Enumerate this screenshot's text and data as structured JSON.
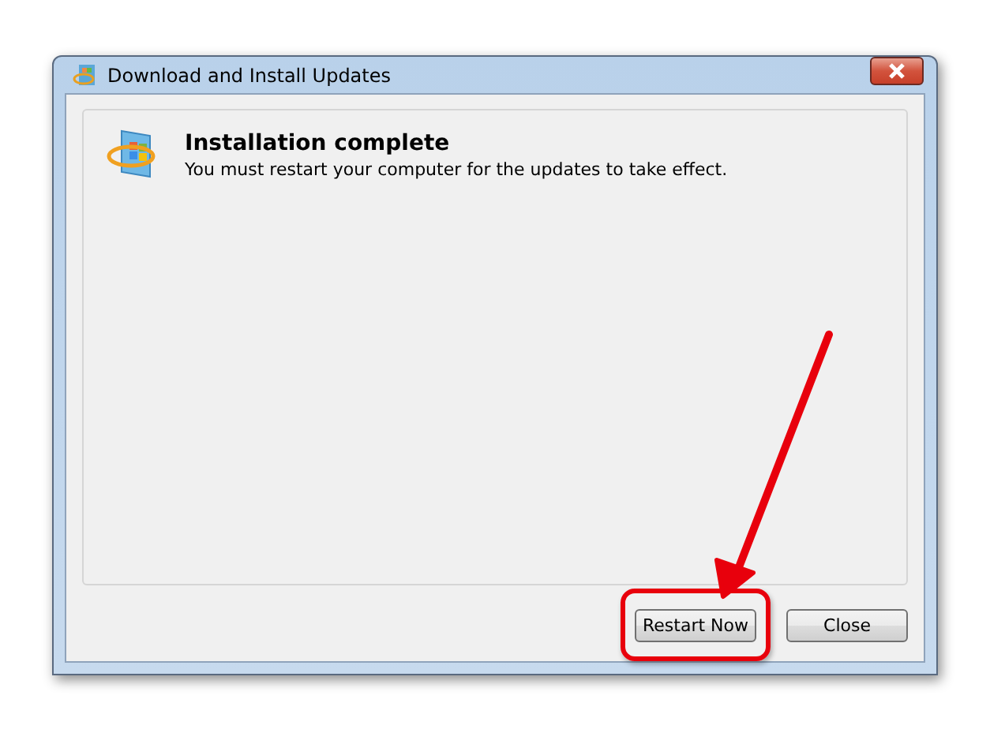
{
  "window": {
    "title": "Download and Install Updates"
  },
  "message": {
    "heading": "Installation complete",
    "text": "You must restart your computer for the updates to take effect."
  },
  "buttons": [
    {
      "label": "Restart Now",
      "highlighted": true
    },
    {
      "label": "Close",
      "highlighted": false
    }
  ]
}
